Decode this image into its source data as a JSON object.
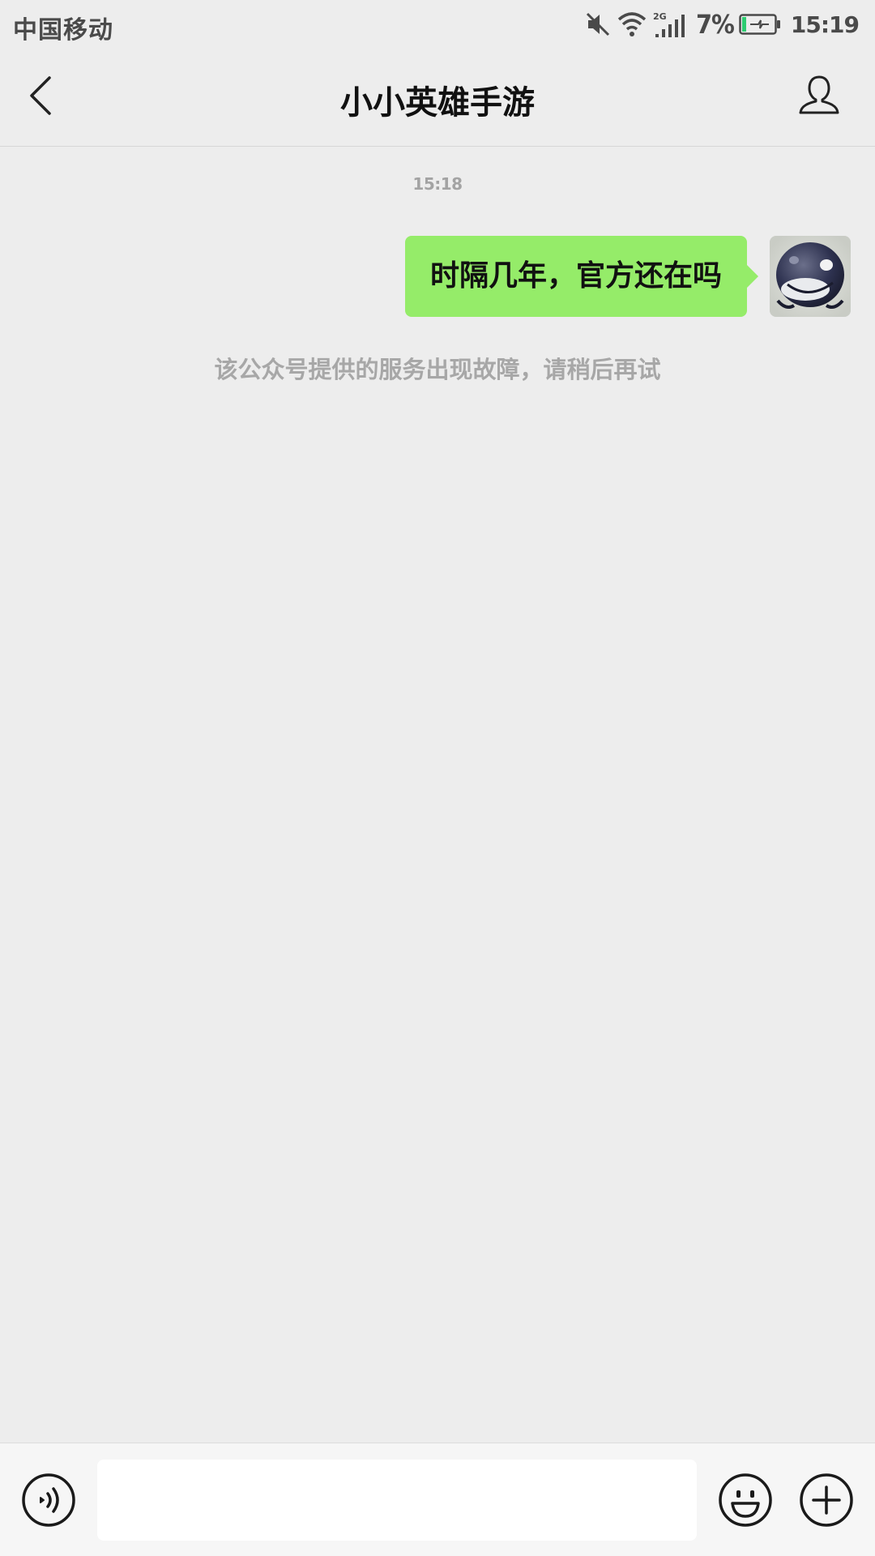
{
  "status_bar": {
    "carrier": "中国移动",
    "network": "2G",
    "battery_percent": "7%",
    "time": "15:19",
    "icons": [
      "mute-icon",
      "wifi-icon",
      "signal-icon",
      "battery-charging-icon"
    ],
    "battery_color": "#2ecc71"
  },
  "header": {
    "title": "小小英雄手游",
    "back_icon": "chevron-left-icon",
    "profile_icon": "person-icon"
  },
  "chat": {
    "timestamp": "15:18",
    "messages": [
      {
        "sender": "self",
        "text": "时隔几年，官方还在吗",
        "bubble_color": "#95ec69",
        "avatar": "avatar-image"
      }
    ],
    "system_notice": "该公众号提供的服务出现故障，请稍后再试"
  },
  "input_bar": {
    "input_value": "",
    "icons": [
      "voice-icon",
      "emoji-icon",
      "plus-icon"
    ]
  },
  "colors": {
    "background": "#ededed",
    "input_bar_background": "#f6f6f6",
    "muted_text": "#a7a7a7"
  }
}
